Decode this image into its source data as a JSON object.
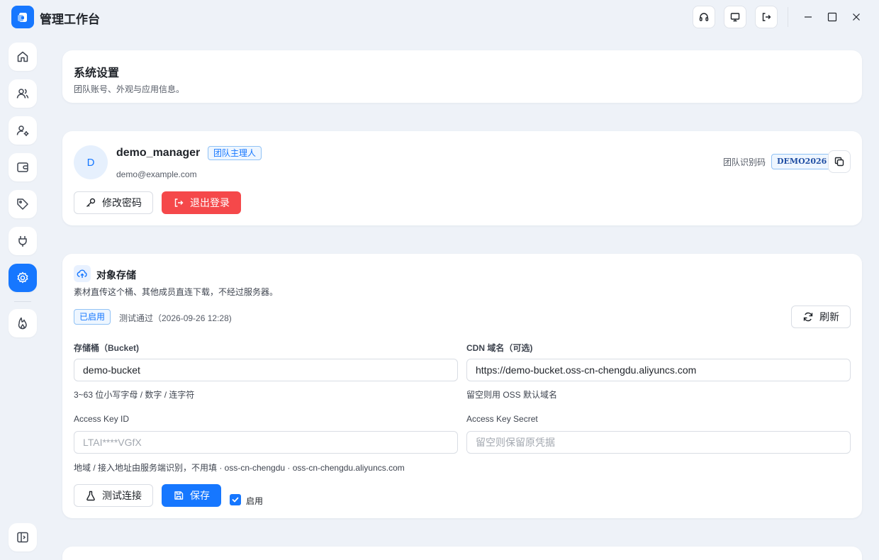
{
  "app": {
    "title": "管理工作台"
  },
  "titlebar": {
    "icons": [
      "headset-icon",
      "monitor-icon",
      "logout-icon"
    ],
    "window_controls": [
      "minimize-icon",
      "maximize-icon",
      "close-icon"
    ]
  },
  "sidebar": {
    "items": [
      {
        "icon": "home-icon",
        "active": false
      },
      {
        "icon": "users-icon",
        "active": false
      },
      {
        "icon": "user-settings-icon",
        "active": false
      },
      {
        "icon": "wallet-icon",
        "active": false
      },
      {
        "icon": "tag-icon",
        "active": false
      },
      {
        "icon": "plug-icon",
        "active": false
      },
      {
        "icon": "gear-icon",
        "active": true
      },
      {
        "icon": "flame-icon",
        "active": false
      }
    ],
    "collapse_icon": "sidebar-toggle-icon"
  },
  "header": {
    "title": "系统设置",
    "subtitle": "团队账号、外观与应用信息。"
  },
  "account": {
    "avatar_letter": "D",
    "username": "demo_manager",
    "role": "团队主理人",
    "email": "demo@example.com",
    "team_code_label": "团队识别码",
    "team_code": "DEMO2026",
    "change_password_label": "修改密码",
    "logout_label": "退出登录"
  },
  "storage": {
    "title": "对象存储",
    "description": "素材直传这个桶、其他成员直连下载，不经过服务器。",
    "status_badge": "已启用",
    "status_text": "测试通过（2026-09-26 12:28)",
    "refresh_label": "刷新",
    "bucket": {
      "label": "存储桶（Bucket)",
      "value": "demo-bucket",
      "hint": "3~63 位小写字母 / 数字 / 连字符"
    },
    "cdn": {
      "label": "CDN 域名（可选)",
      "value": "https://demo-bucket.oss-cn-chengdu.aliyuncs.com",
      "hint": "留空则用 OSS 默认域名"
    },
    "access_key_id": {
      "label": "Access Key ID",
      "placeholder": "LTAI****VGfX"
    },
    "access_key_secret": {
      "label": "Access Key Secret",
      "placeholder": "留空则保留原凭据"
    },
    "region_hint": "地域 / 接入地址由服务端识别，不用填 · oss-cn-chengdu · oss-cn-chengdu.aliyuncs.com",
    "test_label": "测试连接",
    "save_label": "保存",
    "enable_label": "启用",
    "enabled": true
  },
  "colors": {
    "accent": "#1677ff",
    "danger": "#f5484a",
    "background": "#eef2f8"
  }
}
